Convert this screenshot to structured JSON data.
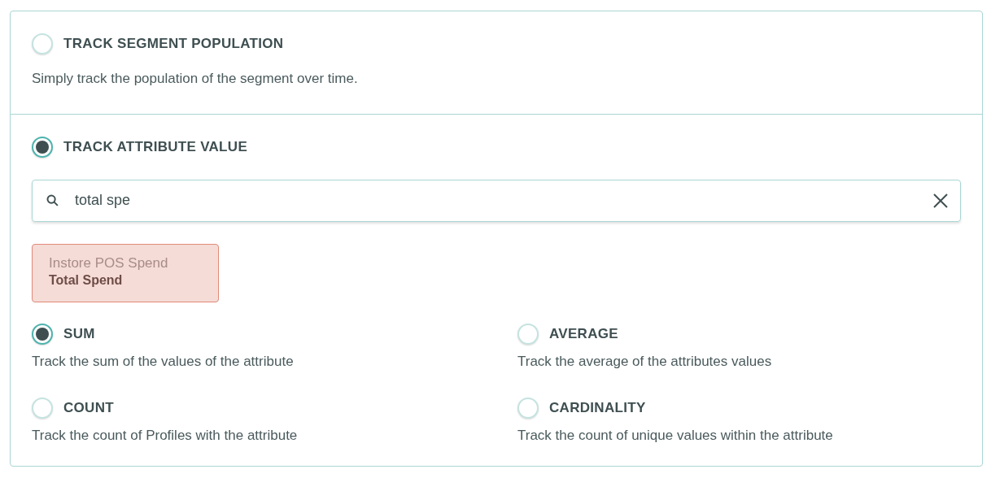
{
  "modes": [
    {
      "label": "TRACK SEGMENT POPULATION",
      "description": "Simply track the population of the segment over time.",
      "selected": false
    },
    {
      "label": "TRACK ATTRIBUTE VALUE",
      "selected": true
    }
  ],
  "search": {
    "value": "total spe"
  },
  "attribute": {
    "group": "Instore POS Spend",
    "name": "Total Spend"
  },
  "aggregations": [
    {
      "label": "SUM",
      "description": "Track the sum of the values of the attribute",
      "selected": true
    },
    {
      "label": "AVERAGE",
      "description": "Track the average of the attributes values",
      "selected": false
    },
    {
      "label": "COUNT",
      "description": "Track the count of Profiles with the attribute",
      "selected": false
    },
    {
      "label": "CARDINALITY",
      "description": "Track the count of unique values within the attribute",
      "selected": false
    }
  ]
}
